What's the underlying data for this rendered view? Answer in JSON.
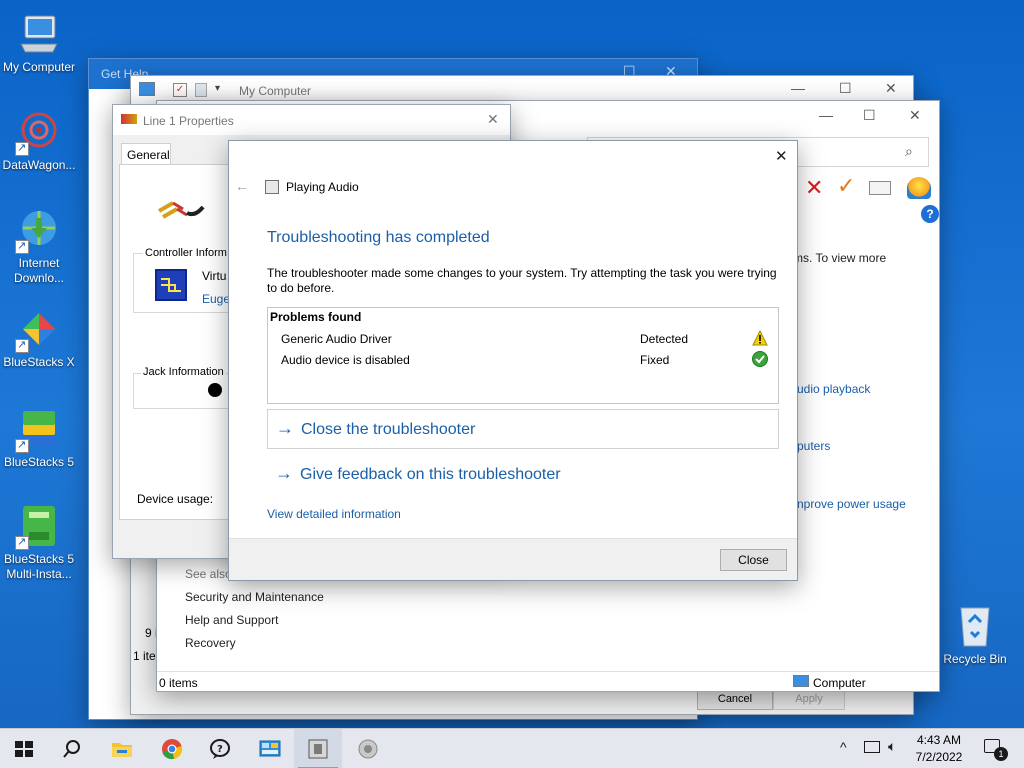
{
  "desktop": {
    "icons": [
      {
        "label": "My Computer"
      },
      {
        "label": "DataWagon..."
      },
      {
        "label": "Internet Downlo..."
      },
      {
        "label": "BlueStacks X"
      },
      {
        "label": "BlueStacks 5"
      },
      {
        "label": "BlueStacks 5 Multi-Insta..."
      },
      {
        "label": "Recycle Bin"
      }
    ]
  },
  "windows": {
    "get_help": {
      "title": "Get Help"
    },
    "my_computer": {
      "title": "My Computer",
      "status_items": "1 ite",
      "count": "9 i",
      "cancel": "Cancel",
      "apply": "Apply"
    },
    "control_panel": {
      "status_left": "0 items",
      "status_right": "Computer",
      "partial_text_1": "ms. To view more",
      "partial_link_1": "udio playback",
      "partial_link_2": "puters",
      "partial_link_3": "nprove power usage",
      "see_also": "See also",
      "links": [
        "Security and Maintenance",
        "Help and Support",
        "Recovery"
      ]
    },
    "line_props": {
      "title": "Line 1 Properties",
      "tab": "General",
      "controller_label": "Controller Inform",
      "controller_name": "Virtu",
      "controller_vendor": "Euge",
      "jack_label": "Jack Information",
      "device_usage": "Device usage:"
    }
  },
  "dialog": {
    "header_title": "Playing Audio",
    "heading": "Troubleshooting has completed",
    "description": "The troubleshooter made some changes to your system. Try attempting the task you were trying to do before.",
    "problems_header": "Problems found",
    "problems": [
      {
        "name": "Generic Audio Driver",
        "status": "Detected",
        "icon": "warning-icon"
      },
      {
        "name": "Audio device is disabled",
        "status": "Fixed",
        "icon": "check-icon"
      }
    ],
    "close_troubleshooter": "Close the troubleshooter",
    "give_feedback": "Give feedback on this troubleshooter",
    "view_details": "View detailed information",
    "close_button": "Close"
  },
  "taskbar": {
    "time": "4:43 AM",
    "date": "7/2/2022",
    "notification_count": "1"
  },
  "colors": {
    "accent": "#1b5fa8",
    "desktop": "#0a64c8"
  }
}
